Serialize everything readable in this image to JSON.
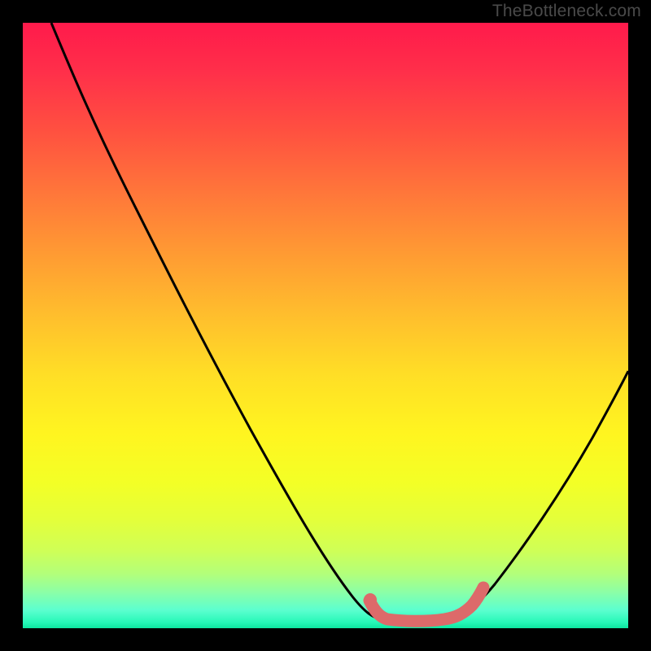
{
  "watermark": "TheBottleneck.com",
  "chart_data": {
    "type": "line",
    "title": "",
    "xlabel": "",
    "ylabel": "",
    "xlim": [
      0,
      100
    ],
    "ylim": [
      0,
      100
    ],
    "series": [
      {
        "name": "bottleneck-curve",
        "x": [
          5,
          10,
          15,
          20,
          25,
          30,
          35,
          40,
          45,
          50,
          55,
          58,
          62,
          66,
          70,
          75,
          80,
          85,
          90,
          95,
          100
        ],
        "y": [
          100,
          92,
          83,
          74,
          65,
          56,
          47,
          38,
          29,
          20,
          11,
          5,
          2,
          2,
          2,
          4,
          9,
          15,
          22,
          30,
          40
        ]
      },
      {
        "name": "optimal-zone-highlight",
        "x": [
          58,
          60,
          62,
          64,
          66,
          68,
          70,
          71
        ],
        "y": [
          5,
          3,
          2,
          2,
          2,
          2,
          2.5,
          4
        ]
      }
    ],
    "colors": {
      "curve": "#000000",
      "highlight": "#dd6a6a",
      "gradient_top": "#ff1a4b",
      "gradient_bottom": "#0de6a0"
    }
  }
}
